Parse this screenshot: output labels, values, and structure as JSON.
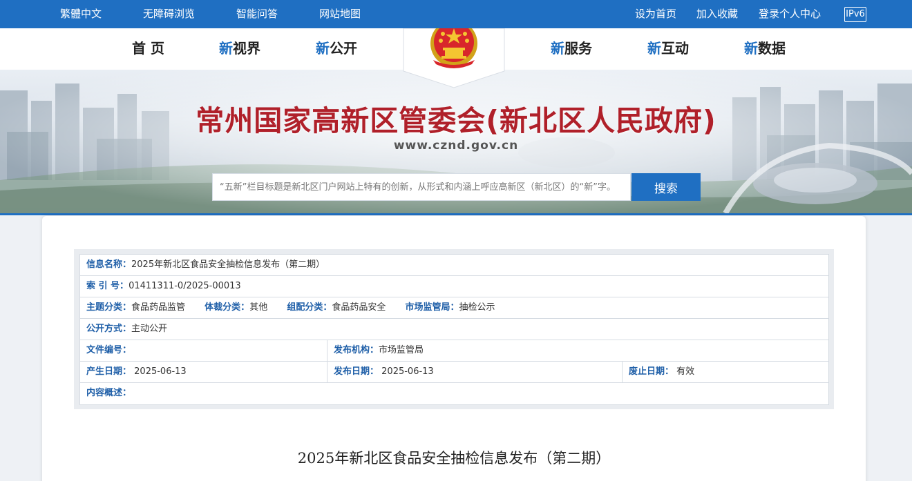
{
  "topbar": {
    "traditional": "繁體中文",
    "accessible": "无障碍浏览",
    "qa": "智能问答",
    "sitemap": "网站地图",
    "set_home": "设为首页",
    "bookmark": "加入收藏",
    "login": "登录个人中心",
    "ipv6": "IPv6"
  },
  "nav": {
    "home": "首 页",
    "vision_hl": "新",
    "vision": "视界",
    "open_hl": "新",
    "open": "公开",
    "service_hl": "新",
    "service": "服务",
    "interact_hl": "新",
    "interact": "互动",
    "data_hl": "新",
    "data": "数据"
  },
  "banner": {
    "title": "常州国家高新区管委会(新北区人民政府)",
    "url": "www.cznd.gov.cn",
    "search_placeholder": "“五新”栏目标题是新北区门户网站上特有的创新，从形式和内涵上呼应高新区（新北区）的“新”字。",
    "search_button": "搜索"
  },
  "info": {
    "name_label": "信息名称：",
    "name_value": "2025年新北区食品安全抽检信息发布（第二期）",
    "index_label": "索 引 号：",
    "index_value": "01411311-0/2025-00013",
    "topic_label": "主题分类：",
    "topic_value": "食品药品监管",
    "genre_label": "体裁分类：",
    "genre_value": "其他",
    "org_label": "组配分类：",
    "org_value": "食品药品安全",
    "market_label": "市场监管局：",
    "market_value": "抽检公示",
    "mode_label": "公开方式：",
    "mode_value": "主动公开",
    "fileno_label": "文件编号：",
    "fileno_value": "",
    "issuer_label": "发布机构：",
    "issuer_value": "市场监管局",
    "created_label": "产生日期：",
    "created_value": "2025-06-13",
    "published_label": "发布日期：",
    "published_value": "2025-06-13",
    "expiry_label": "废止日期：",
    "expiry_value": "有效",
    "summary_label": "内容概述：",
    "summary_value": ""
  },
  "article": {
    "title": "2025年新北区食品安全抽检信息发布（第二期）"
  },
  "colors": {
    "brand_blue": "#1f6fc2",
    "title_red": "#b0202a"
  }
}
